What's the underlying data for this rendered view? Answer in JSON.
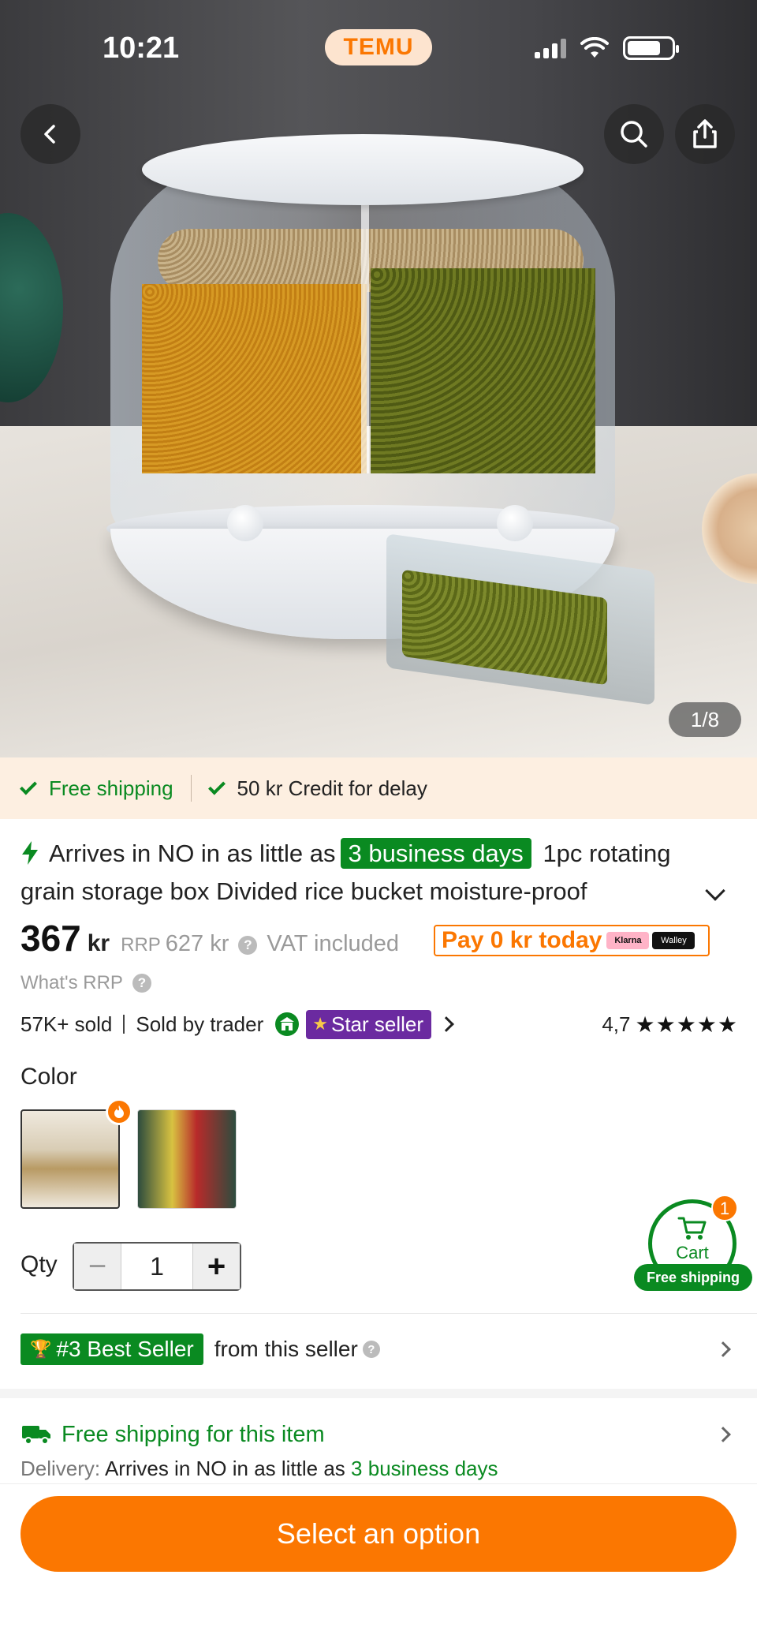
{
  "status_bar": {
    "time": "10:21",
    "battery_level": 0.75
  },
  "brand": {
    "logo_text": "TEMU",
    "accent": "#fb7701",
    "green": "#0a8a21"
  },
  "gallery": {
    "counter": "1/8"
  },
  "shipping_strip": {
    "free_shipping": "Free shipping",
    "credit": "50 kr Credit for delay"
  },
  "title": {
    "prefix": "Arrives in NO in as little as",
    "days_badge": "3 business days",
    "product_name": "1pc rotating grain storage box Divided rice bucket moisture-proof"
  },
  "price": {
    "amount": "367",
    "currency": "kr",
    "rrp_label": "RRP",
    "rrp_value": "627 kr",
    "vat": "VAT included",
    "pay_today": "Pay 0 kr today",
    "klarna": "Klarna",
    "walley": "Walley",
    "whats_rrp": "What's RRP"
  },
  "seller": {
    "sold": "57K+ sold",
    "sold_by": "Sold by trader",
    "badge": "Star seller",
    "rating": "4,7",
    "stars": "★★★★★"
  },
  "color": {
    "label": "Color",
    "options": [
      {
        "name": "white-beige",
        "selected": true
      },
      {
        "name": "dark-green",
        "selected": false
      }
    ]
  },
  "qty": {
    "label": "Qty",
    "value": "1",
    "minus": "−",
    "plus": "+"
  },
  "cart": {
    "label": "Cart",
    "count": "1",
    "shipping": "Free shipping"
  },
  "best_seller": {
    "badge": "#3 Best Seller",
    "text": "from this seller"
  },
  "free_shipping_item": {
    "title": "Free shipping for this item",
    "delivery_label": "Delivery:",
    "delivery_text": "Arrives in NO in as little as",
    "delivery_days": "3 business days"
  },
  "cta": {
    "label": "Select an option"
  }
}
